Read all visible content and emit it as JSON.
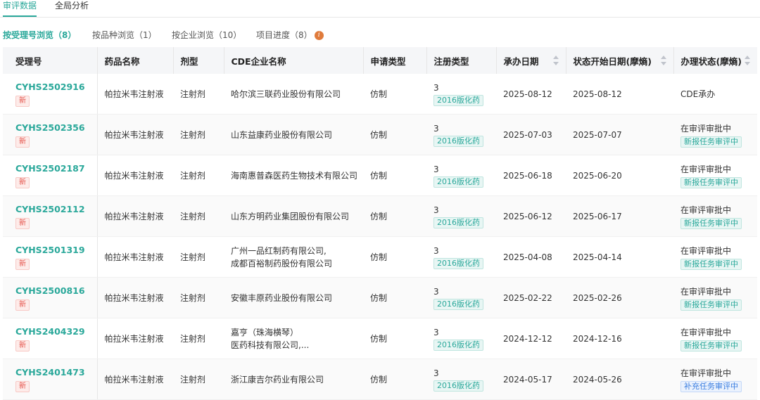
{
  "top_tabs": [
    "审评数据",
    "全局分析"
  ],
  "sub_tabs": [
    {
      "label": "按受理号浏览（8）"
    },
    {
      "label": "按品种浏览（1）"
    },
    {
      "label": "按企业浏览（10）"
    },
    {
      "label": "项目进度（8）"
    }
  ],
  "columns": [
    "受理号",
    "药品名称",
    "剂型",
    "CDE企业名称",
    "申请类型",
    "注册类型",
    "承办日期",
    "状态开始日期(摩熵)",
    "办理状态(摩熵)"
  ],
  "rows": [
    {
      "acc": "CYHS2502916",
      "badge": "新",
      "drug": "帕拉米韦注射液",
      "form": "注射剂",
      "company": [
        "哈尔滨三联药业股份有限公司"
      ],
      "apptype": "仿制",
      "regnum": "3",
      "regtag": "2016版化药",
      "date1": "2025-08-12",
      "date2": "2025-08-12",
      "status": "CDE承办",
      "status_tag": ""
    },
    {
      "acc": "CYHS2502356",
      "badge": "新",
      "drug": "帕拉米韦注射液",
      "form": "注射剂",
      "company": [
        "山东益康药业股份有限公司"
      ],
      "apptype": "仿制",
      "regnum": "3",
      "regtag": "2016版化药",
      "date1": "2025-07-03",
      "date2": "2025-07-07",
      "status": "在审评审批中",
      "status_tag": "新报任务审评中"
    },
    {
      "acc": "CYHS2502187",
      "badge": "新",
      "drug": "帕拉米韦注射液",
      "form": "注射剂",
      "company": [
        "海南惠普森医药生物技术有限公司"
      ],
      "apptype": "仿制",
      "regnum": "3",
      "regtag": "2016版化药",
      "date1": "2025-06-18",
      "date2": "2025-06-20",
      "status": "在审评审批中",
      "status_tag": "新报任务审评中"
    },
    {
      "acc": "CYHS2502112",
      "badge": "新",
      "drug": "帕拉米韦注射液",
      "form": "注射剂",
      "company": [
        "山东方明药业集团股份有限公司"
      ],
      "apptype": "仿制",
      "regnum": "3",
      "regtag": "2016版化药",
      "date1": "2025-06-12",
      "date2": "2025-06-17",
      "status": "在审评审批中",
      "status_tag": "新报任务审评中"
    },
    {
      "acc": "CYHS2501319",
      "badge": "新",
      "drug": "帕拉米韦注射液",
      "form": "注射剂",
      "company": [
        "广州一品红制药有限公司,",
        "成都百裕制药股份有限公司"
      ],
      "apptype": "仿制",
      "regnum": "3",
      "regtag": "2016版化药",
      "date1": "2025-04-08",
      "date2": "2025-04-14",
      "status": "在审评审批中",
      "status_tag": "新报任务审评中"
    },
    {
      "acc": "CYHS2500816",
      "badge": "新",
      "drug": "帕拉米韦注射液",
      "form": "注射剂",
      "company": [
        "安徽丰原药业股份有限公司"
      ],
      "apptype": "仿制",
      "regnum": "3",
      "regtag": "2016版化药",
      "date1": "2025-02-22",
      "date2": "2025-02-26",
      "status": "在审评审批中",
      "status_tag": "新报任务审评中"
    },
    {
      "acc": "CYHS2404329",
      "badge": "新",
      "drug": "帕拉米韦注射液",
      "form": "注射剂",
      "company": [
        "嘉亨（珠海横琴）",
        "医药科技有限公司,..."
      ],
      "apptype": "仿制",
      "regnum": "3",
      "regtag": "2016版化药",
      "date1": "2024-12-12",
      "date2": "2024-12-16",
      "status": "在审评审批中",
      "status_tag": "新报任务审评中"
    },
    {
      "acc": "CYHS2401473",
      "badge": "新",
      "drug": "帕拉米韦注射液",
      "form": "注射剂",
      "company": [
        "浙江康吉尔药业有限公司"
      ],
      "apptype": "仿制",
      "regnum": "3",
      "regtag": "2016版化药",
      "date1": "2024-05-17",
      "date2": "2024-05-26",
      "status": "在审评审批中",
      "status_tag": "补充任务审评中",
      "status_tag_color": "blue"
    }
  ]
}
